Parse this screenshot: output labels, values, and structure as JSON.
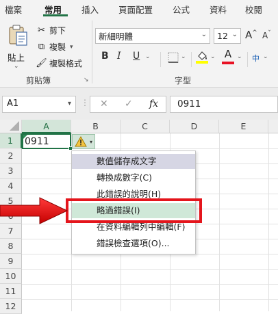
{
  "ribbon_tabs": [
    "檔案",
    "常用",
    "插入",
    "頁面配置",
    "公式",
    "資料",
    "校閱"
  ],
  "active_tab": "常用",
  "clipboard": {
    "paste_label": "貼上",
    "cut_label": "剪下",
    "copy_label": "複製",
    "format_painter_label": "複製格式",
    "group_label": "剪貼簿"
  },
  "font": {
    "font_name": "新細明體",
    "font_size": "12",
    "grow_label": "A",
    "shrink_label": "A",
    "bold": "B",
    "italic": "I",
    "underline": "U",
    "font_color_label": "A",
    "phonetic_label": "中",
    "group_label": "字型",
    "highlight_color": "#ffff00",
    "font_color": "#e81123"
  },
  "formula_bar": {
    "name_box": "A1",
    "cancel_icon": "✕",
    "enter_icon": "✓",
    "fx_label": "fx",
    "formula_value": "0911"
  },
  "grid": {
    "columns": [
      "A",
      "B",
      "C",
      "D",
      "E"
    ],
    "rows": [
      "1",
      "2",
      "3",
      "4",
      "5",
      "6",
      "7",
      "8",
      "9",
      "10",
      "11",
      "12"
    ],
    "cell_A1": "0911",
    "selected_cell": "A1"
  },
  "error_menu": {
    "items": [
      {
        "text": "數值儲存成文字",
        "header": true
      },
      {
        "text": "轉換成數字(C)",
        "highlight": false
      },
      {
        "text": "此錯誤的說明(H)",
        "highlight": false
      },
      {
        "text": "略過錯誤(I)",
        "highlight": true
      },
      {
        "text": "在資料編輯列中編輯(F)",
        "highlight": false
      },
      {
        "text": "錯誤檢查選項(O)...",
        "highlight": false
      }
    ]
  },
  "annotation": {
    "box_color": "#e4151c",
    "arrow_color": "#e4151c"
  }
}
